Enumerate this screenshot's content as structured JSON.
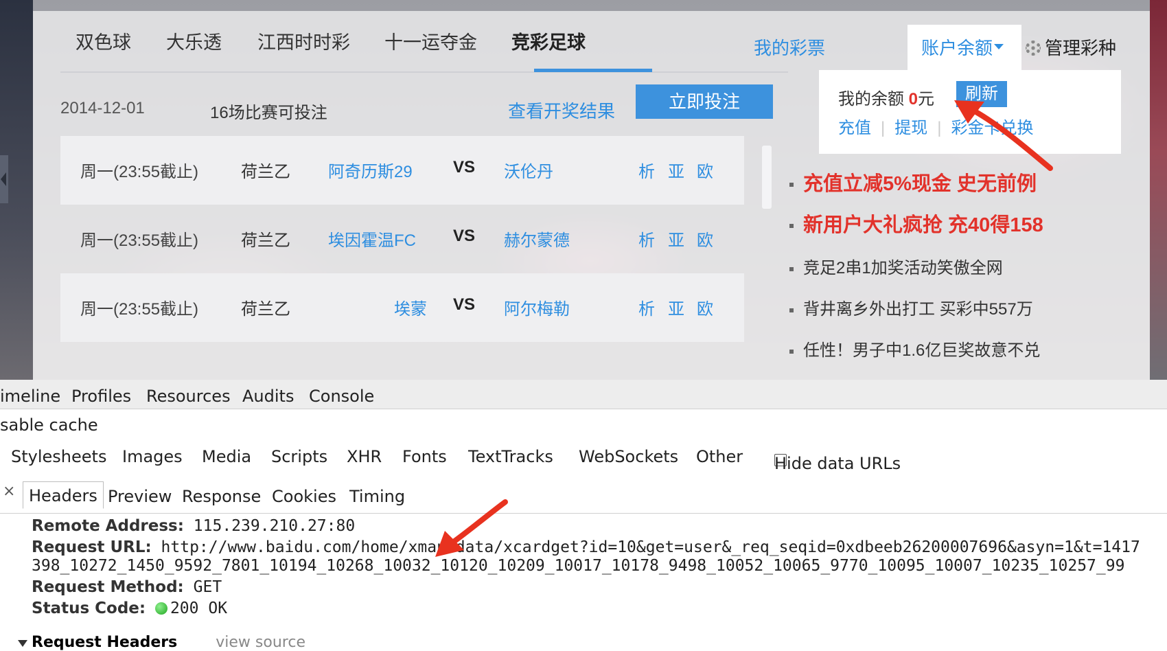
{
  "nav": {
    "tabs": [
      "双色球",
      "大乐透",
      "江西时时彩",
      "十一运夺金",
      "竞彩足球"
    ],
    "my_lottery": "我的彩票",
    "account_balance": "账户余额",
    "manage_lottery": "管理彩种"
  },
  "dropdown": {
    "balance_prefix": "我的余额",
    "balance_amount": "0",
    "balance_unit": "元",
    "refresh": "刷新",
    "recharge": "充值",
    "withdraw": "提现",
    "card": "彩金卡兑换"
  },
  "info": {
    "date": "2014-12-01",
    "count_text": "16场比赛可投注",
    "view_results": "查看开奖结果",
    "bet_now": "立即投注"
  },
  "matches": [
    {
      "time": "周一(23:55截止)",
      "league": "荷兰乙",
      "home": "阿奇历斯29",
      "vs": "VS",
      "away": "沃伦丹",
      "a": "析",
      "b": "亚",
      "c": "欧"
    },
    {
      "time": "周一(23:55截止)",
      "league": "荷兰乙",
      "home": "埃因霍温FC",
      "vs": "VS",
      "away": "赫尔蒙德",
      "a": "析",
      "b": "亚",
      "c": "欧"
    },
    {
      "time": "周一(23:55截止)",
      "league": "荷兰乙",
      "home": "埃蒙",
      "vs": "VS",
      "away": "阿尔梅勒",
      "a": "析",
      "b": "亚",
      "c": "欧"
    }
  ],
  "news": [
    {
      "text": "充值立减5%现金 史无前例",
      "hot": true
    },
    {
      "text": "新用户大礼疯抢 充40得158",
      "hot": true
    },
    {
      "text": "竞足2串1加奖活动笑傲全网",
      "hot": false
    },
    {
      "text": "背井离乡外出打工 买彩中557万",
      "hot": false
    },
    {
      "text": "任性！男子中1.6亿巨奖故意不兑",
      "hot": false
    }
  ],
  "devtools": {
    "panels": [
      "imeline",
      "Profiles",
      "Resources",
      "Audits",
      "Console"
    ],
    "disable_cache": "sable cache",
    "filters": [
      "Stylesheets",
      "Images",
      "Media",
      "Scripts",
      "XHR",
      "Fonts",
      "TextTracks",
      "WebSockets",
      "Other"
    ],
    "hide_data_urls": "Hide data URLs",
    "close": "×",
    "detail_tabs": [
      "Headers",
      "Preview",
      "Response",
      "Cookies",
      "Timing"
    ],
    "remote_address_label": "Remote Address:",
    "remote_address": "115.239.210.27:80",
    "request_url_label": "Request URL:",
    "request_url": "http://www.baidu.com/home/xman/data/xcardget?id=10&get=user&_req_seqid=0xdbeeb26200007696&asyn=1&t=1417",
    "request_url_cont": "398_10272_1450_9592_7801_10194_10268_10032_10120_10209_10017_10178_9498_10052_10065_9770_10095_10007_10235_10257_99",
    "method_label": "Request Method:",
    "method": "GET",
    "status_label": "Status Code:",
    "status": "200 OK",
    "request_headers": "Request Headers",
    "view_source": "view source"
  },
  "colors": {
    "accent": "#3d92dd",
    "link": "#2e8ee0",
    "hot_red": "#e2322b",
    "arrow_red": "#e8321f"
  }
}
